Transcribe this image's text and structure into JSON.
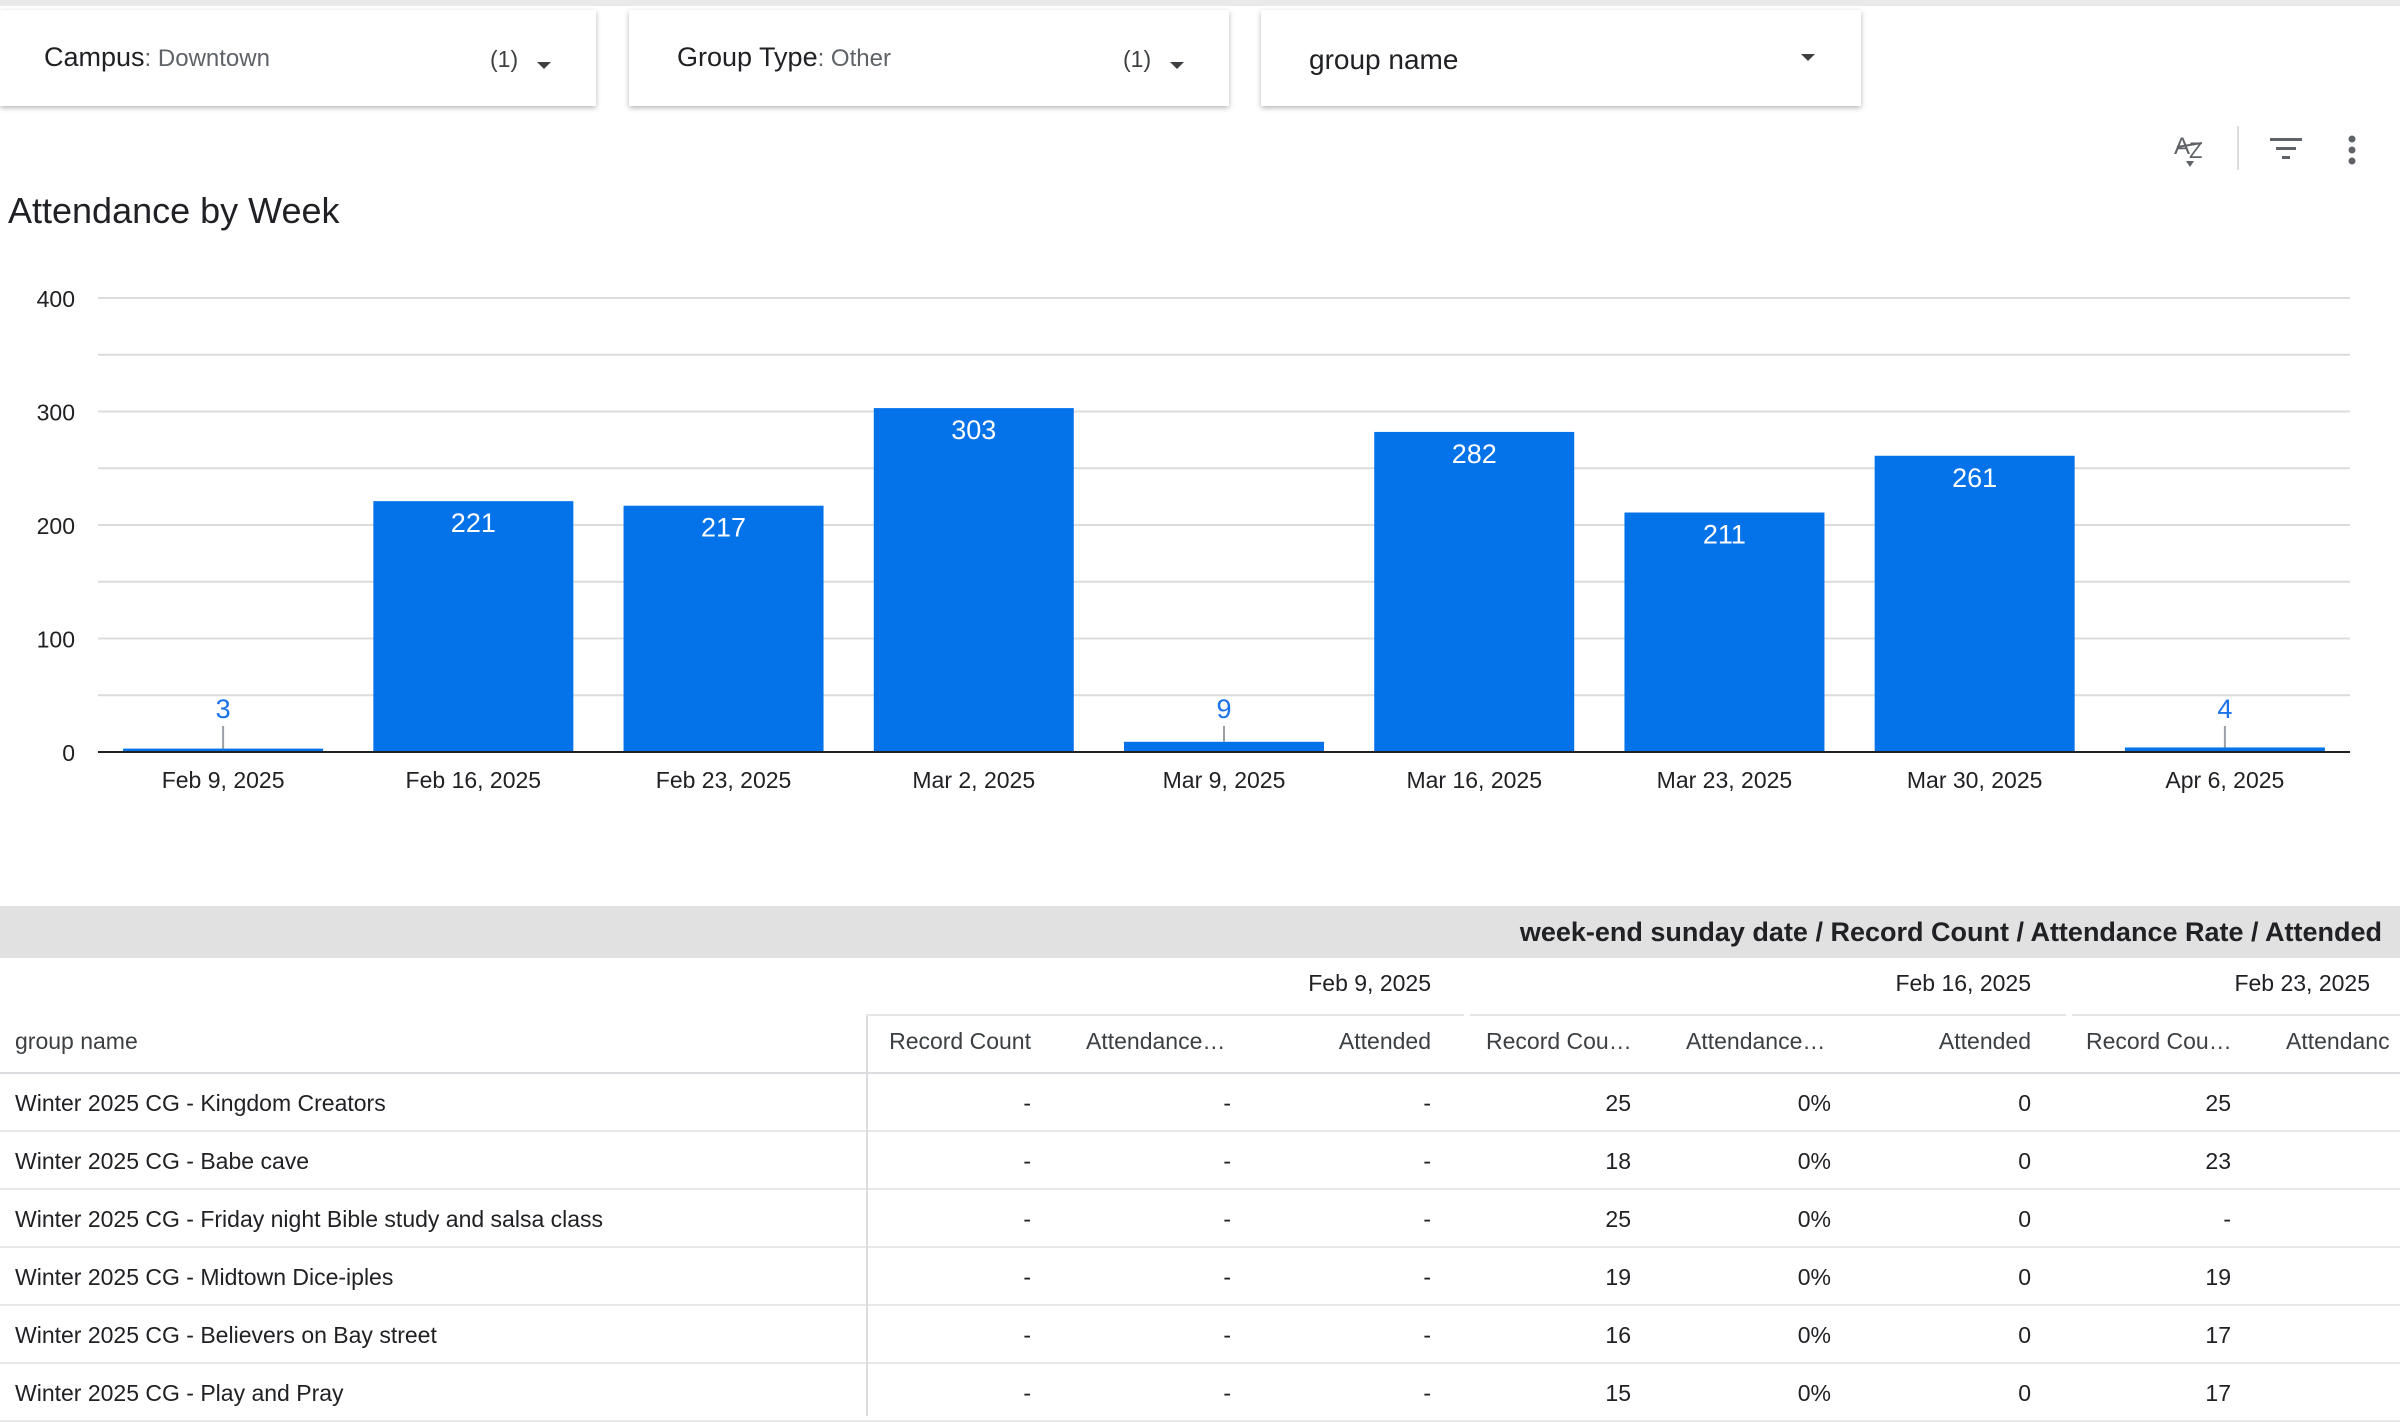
{
  "filters": [
    {
      "label": "Campus",
      "value": ": Downtown",
      "count": "(1)"
    },
    {
      "label": "Group Type",
      "value": ": Other",
      "count": "(1)"
    },
    {
      "label": "group name",
      "value": "",
      "count": ""
    }
  ],
  "icons": {
    "sort": "sort-az-icon",
    "filter": "filter-icon",
    "more": "more-vert-icon"
  },
  "chart_title": "Attendance by Week",
  "chart_data": {
    "type": "bar",
    "title": "Attendance by Week",
    "categories": [
      "Feb 9, 2025",
      "Feb 16, 2025",
      "Feb 23, 2025",
      "Mar 2, 2025",
      "Mar 9, 2025",
      "Mar 16, 2025",
      "Mar 23, 2025",
      "Mar 30, 2025",
      "Apr 6, 2025"
    ],
    "values": [
      3,
      221,
      217,
      303,
      9,
      282,
      211,
      261,
      4
    ],
    "ylim": [
      0,
      400
    ],
    "yticks": [
      0,
      100,
      200,
      300,
      400
    ],
    "grid": true,
    "bar_color": "#0473ea",
    "label_color_outside": "#1a73e8",
    "label_color_inside": "#ffffff"
  },
  "table": {
    "title": "week-end sunday date / Record Count / Attendance Rate / Attended",
    "row_header": "group name",
    "date_groups": [
      "Feb 9, 2025",
      "Feb 16, 2025",
      "Feb 23, 2025"
    ],
    "columns": [
      "Record Count",
      "Attendance…",
      "Attended",
      "Record Cou…",
      "Attendance…",
      "Attended",
      "Record Cou…",
      "Attendanc"
    ],
    "rows": [
      {
        "name": "Winter 2025 CG - Kingdom Creators",
        "cells": [
          "-",
          "-",
          "-",
          "25",
          "0%",
          "0",
          "25"
        ]
      },
      {
        "name": "Winter 2025 CG - Babe cave",
        "cells": [
          "-",
          "-",
          "-",
          "18",
          "0%",
          "0",
          "23"
        ]
      },
      {
        "name": "Winter 2025 CG - Friday night Bible study and salsa class",
        "cells": [
          "-",
          "-",
          "-",
          "25",
          "0%",
          "0",
          "-"
        ]
      },
      {
        "name": "Winter 2025 CG - Midtown Dice-iples",
        "cells": [
          "-",
          "-",
          "-",
          "19",
          "0%",
          "0",
          "19"
        ]
      },
      {
        "name": "Winter 2025 CG - Believers on Bay street",
        "cells": [
          "-",
          "-",
          "-",
          "16",
          "0%",
          "0",
          "17"
        ]
      },
      {
        "name": "Winter 2025 CG - Play and Pray",
        "cells": [
          "-",
          "-",
          "-",
          "15",
          "0%",
          "0",
          "17"
        ]
      }
    ]
  }
}
